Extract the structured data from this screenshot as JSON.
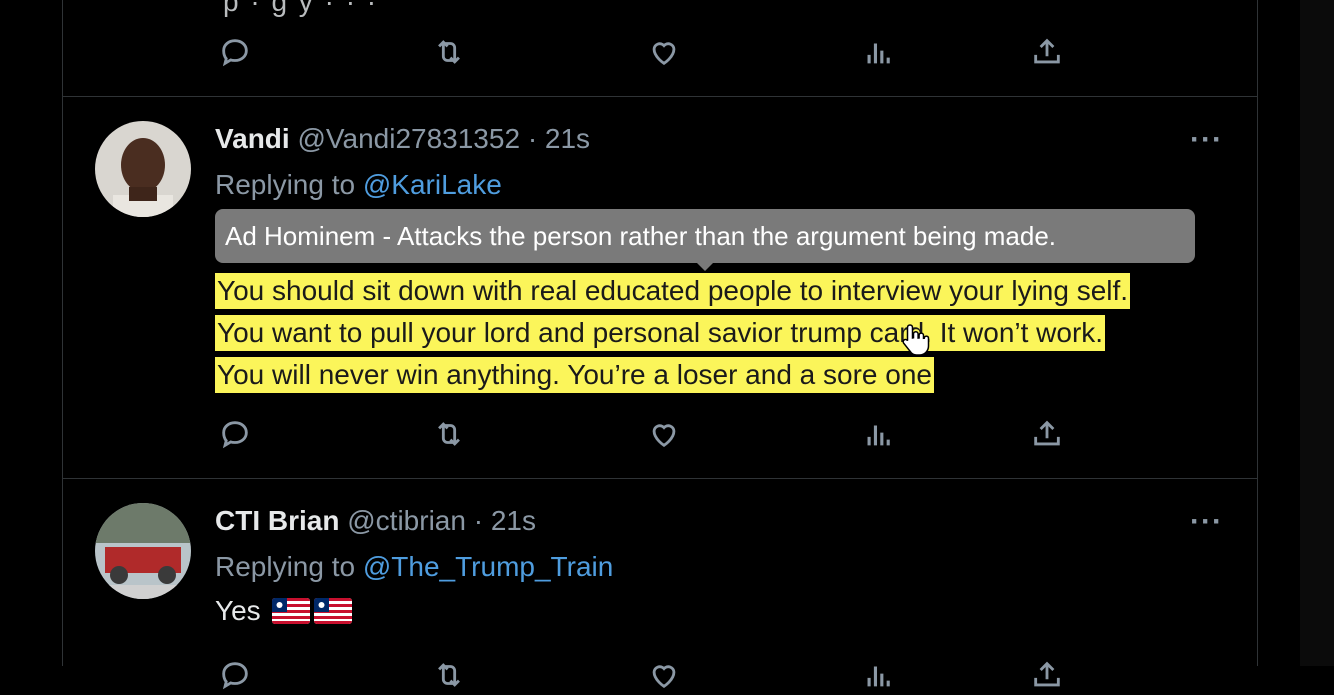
{
  "top_tweet": {
    "partial_text": "  p  ·       g  y  · · ·"
  },
  "tweets": [
    {
      "name": "Vandi",
      "handle": "@Vandi27831352",
      "time": "· 21s",
      "replying_prefix": "Replying to",
      "replying_to": "@KariLake",
      "tooltip": "Ad Hominem - Attacks the person rather than the argument being made.",
      "lines": [
        "You should sit down with real educated people to interview your lying self.",
        "You want to pull your lord and personal savior trump card. It won’t work.",
        "You will never win anything. You’re a loser and a sore one"
      ],
      "more": "···"
    },
    {
      "name": "CTI Brian",
      "handle": "@ctibrian",
      "time": "· 21s",
      "replying_prefix": "Replying to",
      "replying_to": "@The_Trump_Train",
      "text": "Yes",
      "emoji": [
        "flag-liberia",
        "flag-liberia"
      ],
      "more": "···"
    }
  ],
  "action_icons": [
    "reply-icon",
    "retweet-icon",
    "like-icon",
    "views-icon",
    "share-icon"
  ],
  "colors": {
    "background": "#000000",
    "highlight": "#fbf55a",
    "mention": "#4f9ddf",
    "muted": "#8b98a5",
    "tooltip": "#7a7a7a"
  }
}
